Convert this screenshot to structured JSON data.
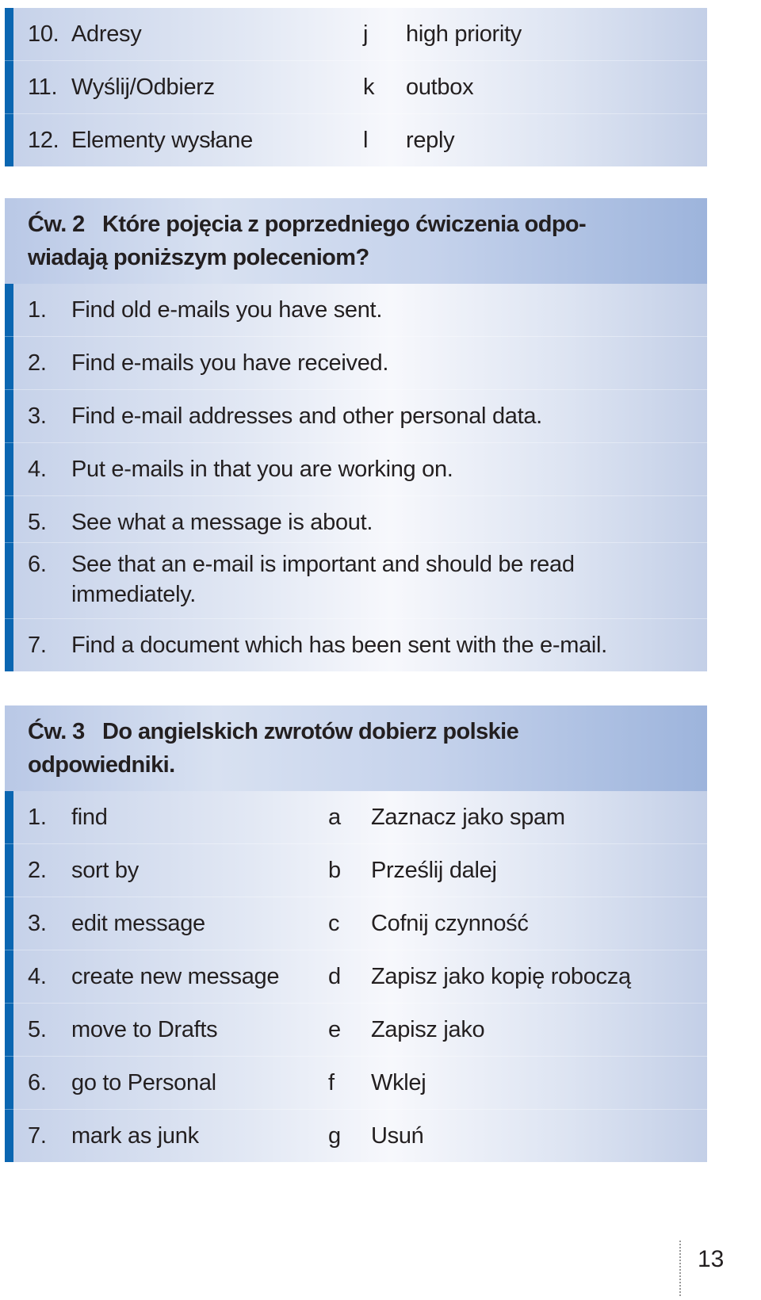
{
  "exercise1_continued": {
    "rows": [
      {
        "num": "10.",
        "text": "Adresy",
        "letter": "j",
        "term": "high priority"
      },
      {
        "num": "11.",
        "text": "Wyślij/Odbierz",
        "letter": "k",
        "term": "outbox"
      },
      {
        "num": "12.",
        "text": "Elementy wysłane",
        "letter": "l",
        "term": "reply"
      }
    ]
  },
  "exercise2": {
    "label": "Ćw. 2",
    "title_line1": "Które pojęcia z poprzedniego ćwiczenia odpo-",
    "title_line2": "wiadają poniższym poleceniom?",
    "items": [
      {
        "num": "1.",
        "text": "Find old e-mails you have sent."
      },
      {
        "num": "2.",
        "text": "Find e-mails you have received."
      },
      {
        "num": "3.",
        "text": "Find e-mail addresses and other personal data."
      },
      {
        "num": "4.",
        "text": "Put e-mails in that you are working on."
      },
      {
        "num": "5.",
        "text": "See what a message is about."
      },
      {
        "num": "6.",
        "text": "See that an e-mail is important and should be read",
        "text2": "immediately."
      },
      {
        "num": "7.",
        "text": "Find a document which has been sent with the e-mail."
      }
    ]
  },
  "exercise3": {
    "label": "Ćw. 3",
    "title_line1": "Do angielskich zwrotów dobierz polskie",
    "title_line2": "odpowiedniki.",
    "rows": [
      {
        "num": "1.",
        "text": "find",
        "letter": "a",
        "term": "Zaznacz jako spam"
      },
      {
        "num": "2.",
        "text": "sort by",
        "letter": "b",
        "term": "Prześlij dalej"
      },
      {
        "num": "3.",
        "text": "edit message",
        "letter": "c",
        "term": "Cofnij czynność"
      },
      {
        "num": "4.",
        "text": "create new message",
        "letter": "d",
        "term": "Zapisz jako kopię roboczą"
      },
      {
        "num": "5.",
        "text": "move to Drafts",
        "letter": "e",
        "term": "Zapisz jako"
      },
      {
        "num": "6.",
        "text": "go to Personal",
        "letter": "f",
        "term": "Wklej"
      },
      {
        "num": "7.",
        "text": "mark as junk",
        "letter": "g",
        "term": "Usuń"
      }
    ]
  },
  "page_number": "13",
  "colors": {
    "accent_bar": "#0b66b1",
    "header_band": "#9db4dc",
    "box_bg": "#c5d1e9"
  }
}
